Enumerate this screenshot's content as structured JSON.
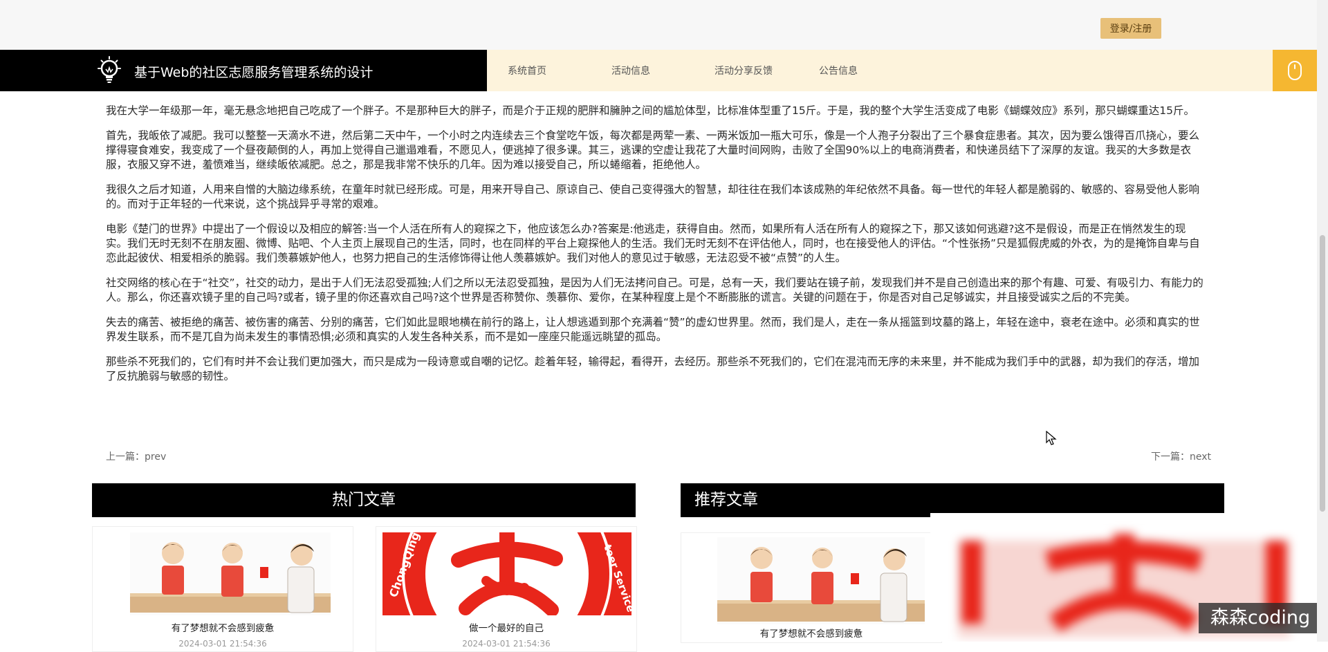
{
  "header": {
    "login_label": "登录/注册",
    "site_title": "基于Web的社区志愿服务管理系统的设计"
  },
  "nav": {
    "items": [
      "系统首页",
      "活动信息",
      "活动分享反馈",
      "公告信息"
    ]
  },
  "article": {
    "paragraphs": [
      "我在大学一年级那一年，毫无悬念地把自己吃成了一个胖子。不是那种巨大的胖子，而是介于正规的肥胖和臃肿之间的尴尬体型，比标准体型重了15斤。于是，我的整个大学生活变成了电影《蝴蝶效应》系列，那只蝴蝶重达15斤。",
      "首先，我皈依了减肥。我可以整整一天滴水不进，然后第二天中午，一个小时之内连续去三个食堂吃午饭，每次都是两荤一素、一两米饭加一瓶大可乐，像是一个人孢子分裂出了三个暴食症患者。其次，因为要么饿得百爪挠心，要么撑得寝食难安，我变成了一个昼夜颠倒的人，再加上觉得自己邋遢难看，不愿见人，便逃掉了很多课。其三，逃课的空虚让我花了大量时间网购，击败了全国90%以上的电商消费者，和快递员结下了深厚的友谊。我买的大多数是衣服，衣服又穿不进，羞愤难当，继续皈依减肥。总之，那是我非常不快乐的几年。因为难以接受自己，所以蜷缩着，拒绝他人。",
      "我很久之后才知道，人用来自憎的大脑边缘系统，在童年时就已经形成。可是，用来开导自己、原谅自己、使自己变得强大的智慧，却往往在我们本该成熟的年纪依然不具备。每一世代的年轻人都是脆弱的、敏感的、容易受他人影响的。而对于正年轻的一代来说，这个挑战异乎寻常的艰难。",
      "电影《楚门的世界》中提出了一个假设以及相应的解答:当一个人活在所有人的窥探之下，他应该怎么办?答案是:他逃走，获得自由。然而，如果所有人活在所有人的窥探之下，那又该如何逃避?这不是假设，而是正在悄然发生的现实。我们无时无刻不在朋友圈、微博、贴吧、个人主页上展现自己的生活，同时，也在同样的平台上窥探他人的生活。我们无时无刻不在评估他人，同时，也在接受他人的评估。“个性张扬”只是狐假虎威的外衣，为的是掩饰自卑与自恋此起彼伏、相爱相杀的脆弱。我们羡慕嫉妒他人，也努力把自己的生活修饰得让他人羡慕嫉妒。我们对他人的意见过于敏感，无法忍受不被“点赞”的人生。",
      "社交网络的核心在于“社交”，社交的动力，是出于人们无法忍受孤独;人们之所以无法忍受孤独，是因为人们无法拷问自己。可是，总有一天，我们要站在镜子前，发现我们并不是自己创造出来的那个有趣、可爱、有吸引力、有能力的人。那么，你还喜欢镜子里的自己吗?或者，镜子里的你还喜欢自己吗?这个世界是否称赞你、羡慕你、爱你，在某种程度上是个不断膨胀的谎言。关键的问题在于，你是否对自己足够诚实，并且接受诚实之后的不完美。",
      "失去的痛苦、被拒绝的痛苦、被伤害的痛苦、分别的痛苦，它们如此显眼地横在前行的路上，让人想逃遁到那个充满着“赞”的虚幻世界里。然而，我们是人，走在一条从摇篮到坟墓的路上，年轻在途中，衰老在途中。必须和真实的世界发生联系，而不是兀自为尚未发生的事情恐惧;必须和真实的人发生各种关系，而不是如一座座只能遥远眺望的孤岛。",
      "那些杀不死我们的，它们有时并不会让我们更加强大，而只是成为一段诗意或自嘲的记忆。趁着年轻，输得起，看得开，去经历。那些杀不死我们的，它们在混沌而无序的未来里，并不能成为我们手中的武器，却为我们的存活，增加了反抗脆弱与敏感的韧性。"
    ],
    "prev": "上一篇：prev",
    "next": "下一篇：next"
  },
  "hot": {
    "title": "热门文章",
    "cards": [
      {
        "caption": "有了梦想就不会感到疲惫",
        "date": "2024-03-01 21:54:36"
      },
      {
        "caption": "做一个最好的自己",
        "date": "2024-03-01 21:54:36"
      }
    ]
  },
  "recommend": {
    "title": "推荐文章",
    "cards": [
      {
        "caption": "有了梦想就不会感到疲惫"
      }
    ]
  },
  "logo_text": "ChongQing",
  "logo_text2": "teer Service",
  "watermark": "森森coding",
  "colors": {
    "login_bg": "#e8c079",
    "nav_bg": "#fdf3dc",
    "brand_bg": "#000000",
    "accent": "#f5b731",
    "logo_red": "#e8261b"
  }
}
